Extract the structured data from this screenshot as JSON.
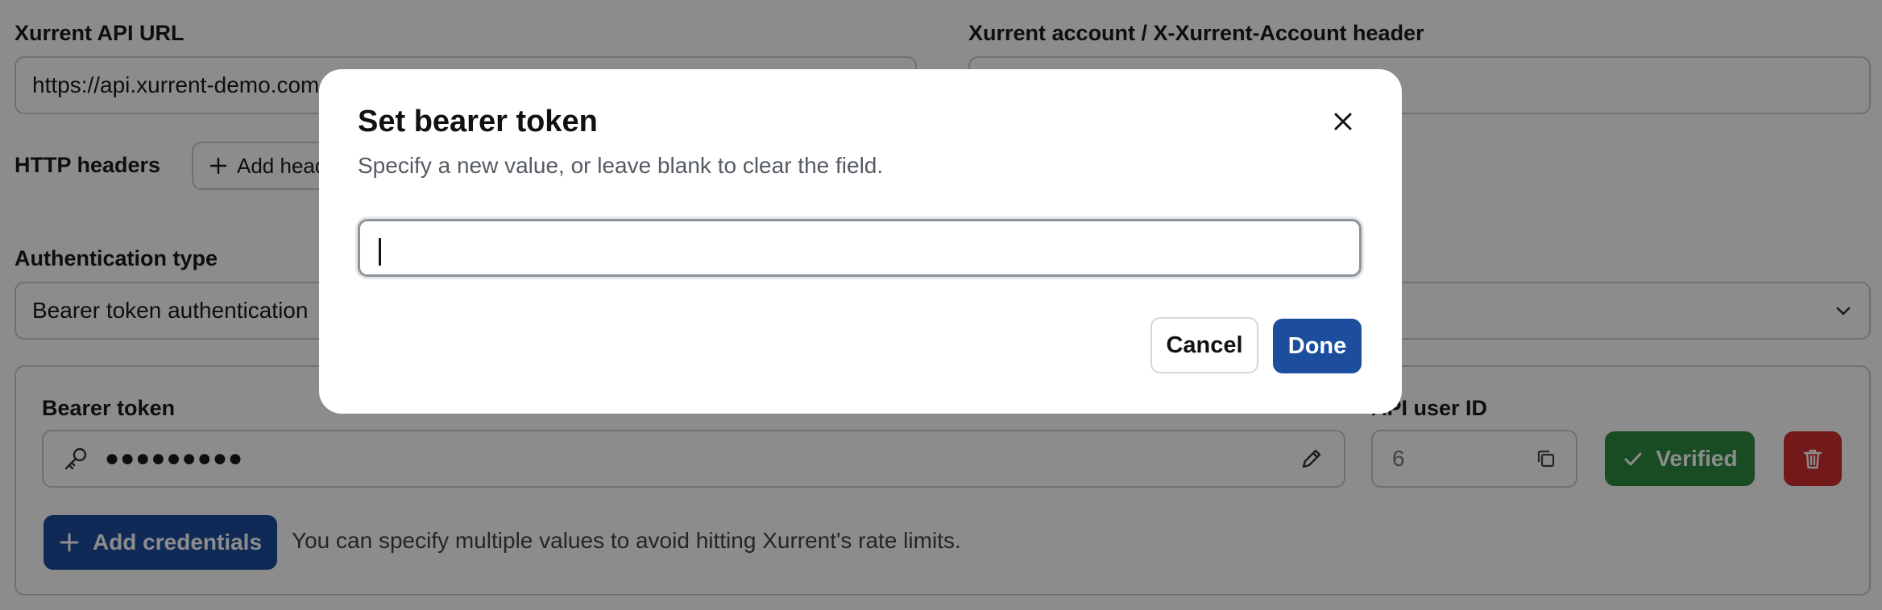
{
  "form": {
    "api_url_label": "Xurrent API URL",
    "api_url_value": "https://api.xurrent-demo.com",
    "account_label": "Xurrent account / X-Xurrent-Account header",
    "account_value": "",
    "http_headers_label": "HTTP headers",
    "add_header_label": "Add header",
    "auth_type_label": "Authentication type",
    "auth_type_value": "Bearer token authentication",
    "bearer_token_label": "Bearer token",
    "bearer_token_value": "●●●●●●●●●",
    "api_user_id_label": "API user ID",
    "api_user_id_value": "6",
    "verified_label": "Verified",
    "add_credentials_label": "Add credentials",
    "add_credentials_hint": "You can specify multiple values to avoid hitting Xurrent's rate limits."
  },
  "dialog": {
    "title": "Set bearer token",
    "subtitle": "Specify a new value, or leave blank to clear the field.",
    "input_value": "",
    "cancel_label": "Cancel",
    "done_label": "Done"
  },
  "colors": {
    "primary": "#1c4e9d",
    "success": "#2e8b3e",
    "danger": "#d32f2f",
    "overlay": "rgba(0,0,0,0.45)"
  }
}
